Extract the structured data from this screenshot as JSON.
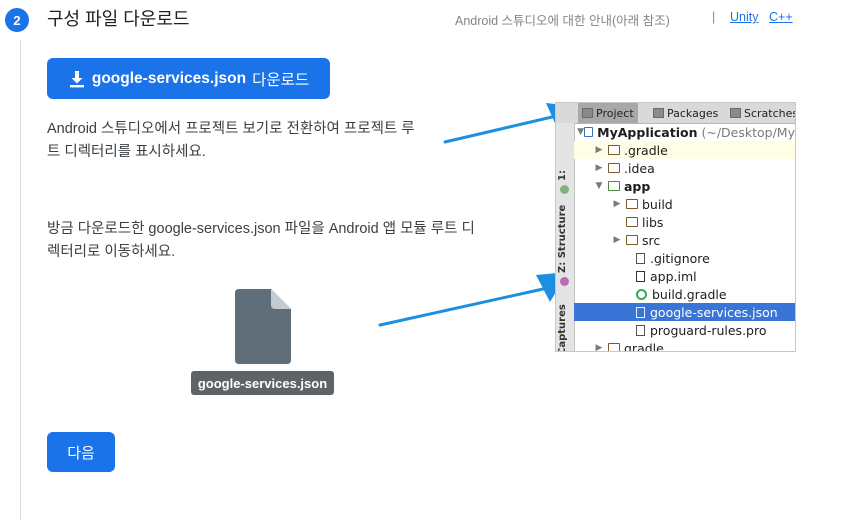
{
  "header": {
    "step_number": "2",
    "title": "구성 파일 다운로드",
    "guide_text": "Android 스튜디오에 대한 안내(아래 참조)",
    "separator": "|",
    "links": {
      "unity": "Unity",
      "cpp": "C++"
    }
  },
  "download_button": {
    "filename": "google-services.json",
    "suffix": "다운로드"
  },
  "instructions": {
    "step1": "Android 스튜디오에서 프로젝트 보기로 전환하여 프로젝트 루트 디렉터리를 표시하세요.",
    "step2": "방금 다운로드한 google-services.json 파일을 Android 앱 모듈 루트 디렉터리로 이동하세요."
  },
  "file_card": {
    "label": "google-services.json"
  },
  "next_button": {
    "label": "다음"
  },
  "ide_panel": {
    "tabs": [
      "Project",
      "Packages",
      "Scratches"
    ],
    "side_labels": [
      "1:",
      "Z: Structure",
      "Captures"
    ],
    "root": {
      "name": "MyApplication",
      "path": "(~/Desktop/My"
    },
    "tree": [
      {
        "name": ".gradle"
      },
      {
        "name": ".idea"
      },
      {
        "name": "app"
      },
      {
        "name": "build"
      },
      {
        "name": "libs"
      },
      {
        "name": "src"
      },
      {
        "name": ".gitignore"
      },
      {
        "name": "app.iml"
      },
      {
        "name": "build.gradle"
      },
      {
        "name": "google-services.json"
      },
      {
        "name": "proguard-rules.pro"
      },
      {
        "name": "gradle"
      }
    ]
  },
  "colors": {
    "accent": "#1a73e8",
    "arrow": "#1e8fe0",
    "selected_row": "#3875d7"
  }
}
